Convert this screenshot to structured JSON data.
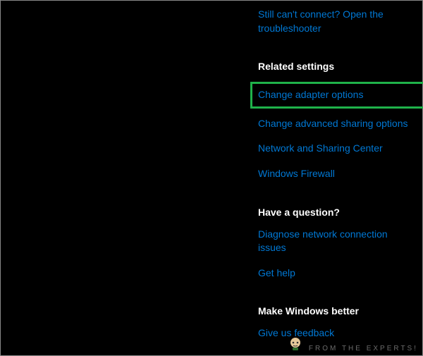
{
  "top_link": "Still can't connect? Open the troubleshooter",
  "sections": {
    "related": {
      "title": "Related settings",
      "change_adapter": "Change adapter options",
      "advanced_sharing": "Change advanced sharing options",
      "network_center": "Network and Sharing Center",
      "firewall": "Windows Firewall"
    },
    "question": {
      "title": "Have a question?",
      "diagnose": "Diagnose network connection issues",
      "help": "Get help"
    },
    "better": {
      "title": "Make Windows better",
      "feedback": "Give us feedback"
    }
  },
  "watermark": "FROM THE EXPERTS!"
}
